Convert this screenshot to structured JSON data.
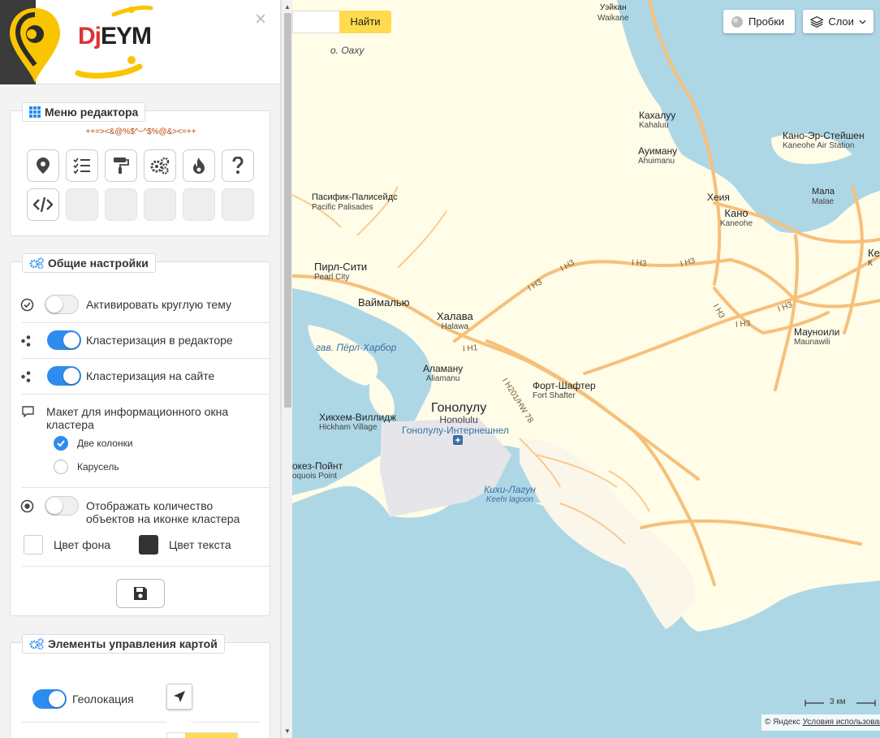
{
  "app": {
    "logo_text": "DjEYM",
    "close_glyph": "×"
  },
  "editor_menu": {
    "title": "Меню редактора",
    "hash_text": "++=><&@%$^~^$%@&><=++",
    "buttons": [
      "map-marker-icon",
      "checklist-icon",
      "paint-roller-icon",
      "gears-icon",
      "fire-icon",
      "question-icon",
      "code-icon",
      "",
      "",
      "",
      "",
      ""
    ]
  },
  "general_settings": {
    "title": "Общие настройки",
    "round_theme": {
      "label": "Активировать круглую тему",
      "enabled": false
    },
    "cluster_editor": {
      "label": "Кластеризация в редакторе",
      "enabled": true
    },
    "cluster_site": {
      "label": "Кластеризация на сайте",
      "enabled": true
    },
    "cluster_layout": {
      "label": "Макет для информационного окна кластера",
      "options": [
        {
          "label": "Две колонки",
          "selected": true
        },
        {
          "label": "Карусель",
          "selected": false
        }
      ]
    },
    "show_count": {
      "label": "Отображать количество объектов на иконке кластера",
      "enabled": false
    },
    "bg_color": {
      "label": "Цвет фона",
      "value": "#ffffff"
    },
    "text_color": {
      "label": "Цвет текста",
      "value": "#333333"
    }
  },
  "map_controls": {
    "title": "Элементы управления картой",
    "geolocation": {
      "label": "Геолокация",
      "enabled": true
    }
  },
  "map": {
    "search_button": "Найти",
    "traffic_button": "Пробки",
    "layers_button": "Слои",
    "scale": "3 км",
    "copyright": "© Яндекс",
    "terms_link": "Условия использования",
    "labels": [
      {
        "name": "Уэйкан",
        "sub": "Waikane"
      },
      {
        "name": "о. Оаху",
        "sub": ""
      },
      {
        "name": "Кахалуу",
        "sub": "Kahaluu"
      },
      {
        "name": "Кано-Эр-Стейшен",
        "sub": "Kaneohe Air Station"
      },
      {
        "name": "Ауиману",
        "sub": "Ahuimanu"
      },
      {
        "name": "Пасифик-Палисейдс",
        "sub": "Pacific Palisades"
      },
      {
        "name": "Хеия",
        "sub": ""
      },
      {
        "name": "Кано",
        "sub": "Kaneohe"
      },
      {
        "name": "Мала",
        "sub": "Malae"
      },
      {
        "name": "Пирл-Сити",
        "sub": "Pearl City"
      },
      {
        "name": "Ваймалью",
        "sub": ""
      },
      {
        "name": "Халава",
        "sub": "Halawa"
      },
      {
        "name": "Мауноили",
        "sub": "Maunawili"
      },
      {
        "name": "Аламану",
        "sub": "Aliamanu"
      },
      {
        "name": "Форт-Шафтер",
        "sub": "Fort Shafter"
      },
      {
        "name": "Гонолулу",
        "sub": "Honolulu"
      },
      {
        "name": "Хикхем-Виллидж",
        "sub": "Hickham Village"
      },
      {
        "name": "окез-Пойнт",
        "sub": "oquois Point"
      },
      {
        "name": "Ке",
        "sub": "К"
      }
    ],
    "water_labels": [
      {
        "name": "гав. Пёрл-Харбор",
        "sub": ""
      },
      {
        "name": "Кихи-Лагун",
        "sub": "Keehi lagoon"
      }
    ],
    "airport_label": "Гонолулу-Интернешнел",
    "highways": [
      "I H3",
      "I H3",
      "I H3",
      "I H3",
      "I H3",
      "I H3",
      "I H3",
      "I H1",
      "I H201/HW 78"
    ]
  }
}
